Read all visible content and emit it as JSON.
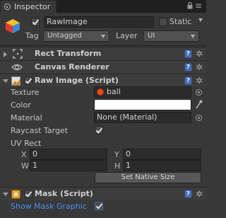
{
  "tab": {
    "title": "Inspector",
    "menu_icon": "≡"
  },
  "gameobject": {
    "name": "RawImage",
    "active": true,
    "static_label": "Static",
    "static": false,
    "tag_label": "Tag",
    "tag_value": "Untagged",
    "layer_label": "Layer",
    "layer_value": "UI"
  },
  "components": {
    "rect_transform": {
      "title": "Rect Transform"
    },
    "canvas_renderer": {
      "title": "Canvas Renderer"
    },
    "raw_image": {
      "title": "Raw Image (Script)",
      "enabled": true,
      "texture_label": "Texture",
      "texture_value": "ball",
      "color_label": "Color",
      "color_value": "#ffffff",
      "material_label": "Material",
      "material_value": "None (Material)",
      "raycast_label": "Raycast Target",
      "raycast_target": true,
      "uvrect_label": "UV Rect",
      "x_label": "X",
      "x_value": "0",
      "y_label": "Y",
      "y_value": "0",
      "w_label": "W",
      "w_value": "1",
      "h_label": "H",
      "h_value": "1",
      "native_size_button": "Set Native Size"
    },
    "mask": {
      "title": "Mask (Script)",
      "enabled": true,
      "show_graphic_label": "Show Mask Graphic",
      "show_graphic": true
    }
  },
  "icons": {
    "help": "?",
    "gear": "✲",
    "canvas_renderer": "eye-icon",
    "rect_transform": "rect-transform-icon"
  },
  "colors": {
    "panel_bg": "#383838",
    "link_blue": "#4c8ff0",
    "help_blue": "#4a6fb0",
    "ball_orange": "#e8501a"
  }
}
